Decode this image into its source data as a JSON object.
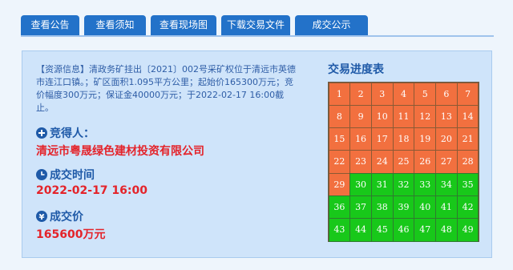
{
  "tabs": [
    {
      "label": "查看公告"
    },
    {
      "label": "查看须知"
    },
    {
      "label": "查看现场图"
    },
    {
      "label": "下载交易文件"
    },
    {
      "label": "成交公示"
    }
  ],
  "info": {
    "text": "【资源信息】清政务矿挂出〔2021〕002号采矿权位于清远市英德市连江口镇。；矿区面积1.095平方公里；起始价165300万元；竞价幅度300万元；保证金40000万元；于2022-02-17 16:00截止。"
  },
  "winner": {
    "label": "竞得人：",
    "value": "清远市粤晟绿色建材投资有限公司"
  },
  "deal_time": {
    "label": "成交时间",
    "value": "2022-02-17 16:00"
  },
  "deal_price": {
    "label": "成交价",
    "value": "165600万元"
  },
  "progress": {
    "title": "交易进度表",
    "total": 49,
    "completed_count": 29,
    "colors": {
      "completed": "#f2703f",
      "pending": "#18c81a"
    }
  },
  "colors": {
    "tab_bg": "#2372c9",
    "panel_bg": "#cfe4fa",
    "heading": "#1f5aa8",
    "highlight": "#e4232a"
  }
}
